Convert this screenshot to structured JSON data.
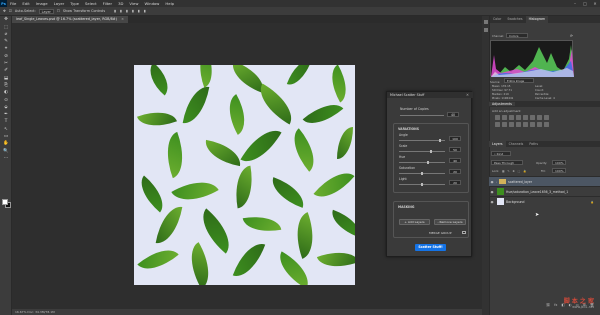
{
  "menubar": {
    "app_logo": "Ps",
    "items": [
      "File",
      "Edit",
      "Image",
      "Layer",
      "Type",
      "Select",
      "Filter",
      "3D",
      "View",
      "Window",
      "Help"
    ],
    "window_controls": [
      "–",
      "□",
      "✕"
    ]
  },
  "options_bar": {
    "auto_select_label": "Auto-Select:",
    "auto_select_value": "Layer",
    "show_transform_label": "Show Transform Controls"
  },
  "document_tab": {
    "title": "leaf_Single_Leaves.psd @ 16.7% (scattered_layer, RGB/8#)",
    "close": "×"
  },
  "tools": [
    "✥",
    "⬚",
    "⌀",
    "✎",
    "⌖",
    "⊘",
    "✂",
    "✐",
    "⬓",
    "⎘",
    "◐",
    "⊙",
    "⬙",
    "✒",
    "T",
    "↖",
    "▭",
    "✋",
    "🔍",
    "⋯"
  ],
  "dialog": {
    "title": "Michael Scatter Stuff",
    "close_icon": "✕",
    "copies_label": "Number of Copies",
    "copies_value": "40",
    "variations_title": "VARIATIONS",
    "variations": [
      {
        "label": "Angle",
        "value": "100"
      },
      {
        "label": "Scale",
        "value": "50"
      },
      {
        "label": "Hue",
        "value": "40"
      },
      {
        "label": "Saturation",
        "value": "20"
      },
      {
        "label": "Light",
        "value": "20"
      }
    ],
    "masking_title": "MASKING",
    "add_layers_label": "+ Add Layers",
    "remove_layers_label": "- Remove Layers",
    "merge_group_label": "MERGE GROUP",
    "scatter_button": "Scatter Stuff!"
  },
  "panels": {
    "top_tabs": [
      "Color",
      "Swatches",
      "Histogram"
    ],
    "histogram": {
      "channel_label": "Channel:",
      "channel_value": "Colors",
      "source_label": "Source:",
      "source_value": "Entire Image",
      "stats_left": [
        {
          "k": "Mean:",
          "v": "176.15"
        },
        {
          "k": "Std Dev:",
          "v": "97.71"
        },
        {
          "k": "Median:",
          "v": "219"
        },
        {
          "k": "Pixels:",
          "v": "1196441"
        }
      ],
      "stats_right": [
        {
          "k": "Level:",
          "v": ""
        },
        {
          "k": "Count:",
          "v": ""
        },
        {
          "k": "Percentile:",
          "v": ""
        },
        {
          "k": "Cache Level:",
          "v": "4"
        }
      ]
    },
    "adjustments": {
      "title": "Adjustments",
      "subtitle": "Add an adjustment"
    },
    "layers_tabs": [
      "Layers",
      "Channels",
      "Paths"
    ],
    "kind_label": "Kind",
    "blend_mode": "Pass Through",
    "opacity_label": "Opacity:",
    "opacity_value": "100%",
    "lock_label": "Lock:",
    "fill_label": "Fill:",
    "fill_value": "100%",
    "layers": [
      {
        "name": "scattered_layer",
        "type": "group"
      },
      {
        "name": "Hue/saturation_Leave1656_3_method_1",
        "type": "layer"
      },
      {
        "name": "Background",
        "type": "background"
      }
    ]
  },
  "statusbar": {
    "text": "16.67%   Doc: 34.3M/78.1M"
  },
  "watermark": {
    "line1": "脚 本 之 家",
    "line2": "www.jb51.net"
  },
  "colors": {
    "accent": "#1473e6",
    "canvas_bg": "#e2e6f5",
    "leaf_dark": "#2e6b18",
    "leaf_mid": "#3d8f1f",
    "leaf_light": "#6cae2f"
  }
}
